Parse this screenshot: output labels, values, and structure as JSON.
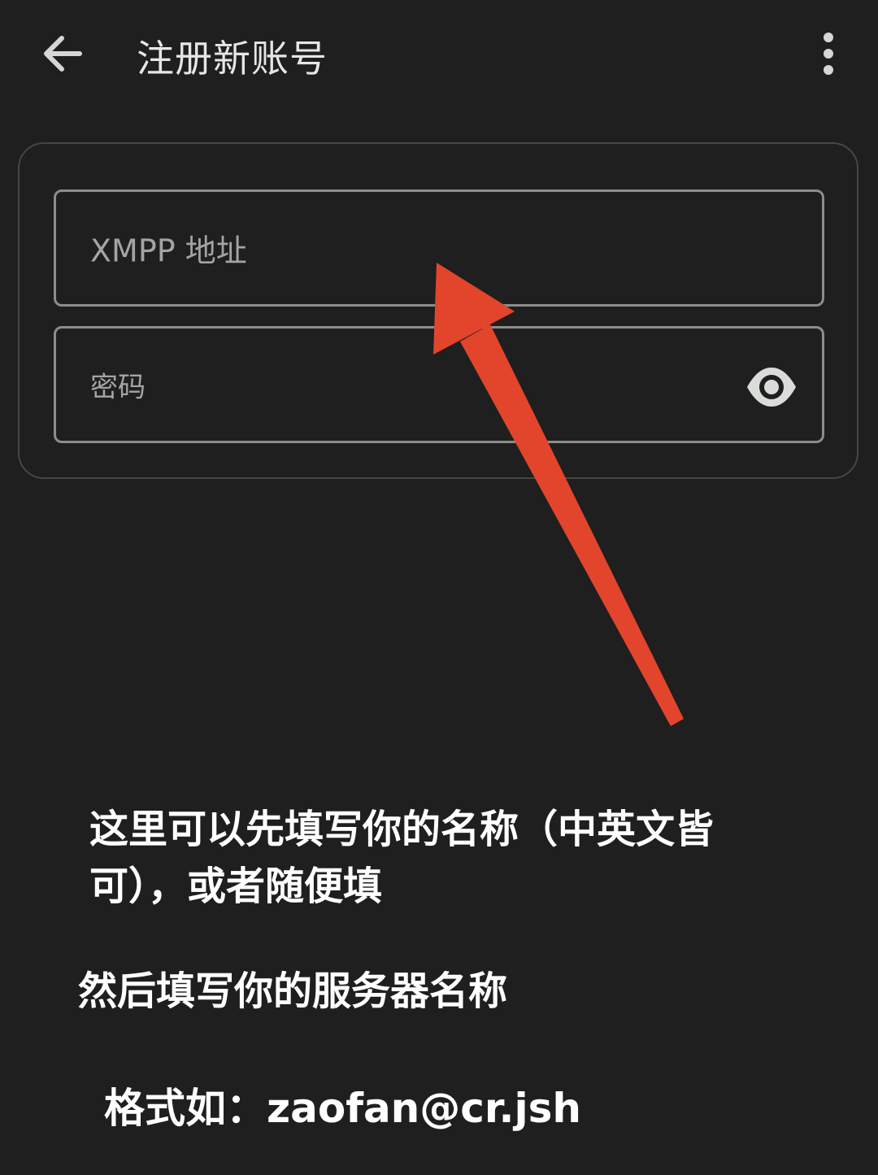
{
  "appbar": {
    "title": "注册新账号",
    "back_icon": "arrow-left-icon",
    "menu_icon": "more-vert-icon"
  },
  "form": {
    "xmpp_placeholder": "XMPP 地址",
    "password_placeholder": "密码",
    "visibility_icon": "eye-icon"
  },
  "annotation": {
    "line1": "这里可以先填写你的名称（中英文皆",
    "line2": "可），或者随便填",
    "line3": "然后填写你的服务器名称",
    "line4": "格式如：zaofan@cr.jsh",
    "arrow_color": "#e2452c"
  },
  "colors": {
    "background": "#1e1f1e",
    "field_border": "#8c8e8b",
    "card_border": "#454745"
  }
}
